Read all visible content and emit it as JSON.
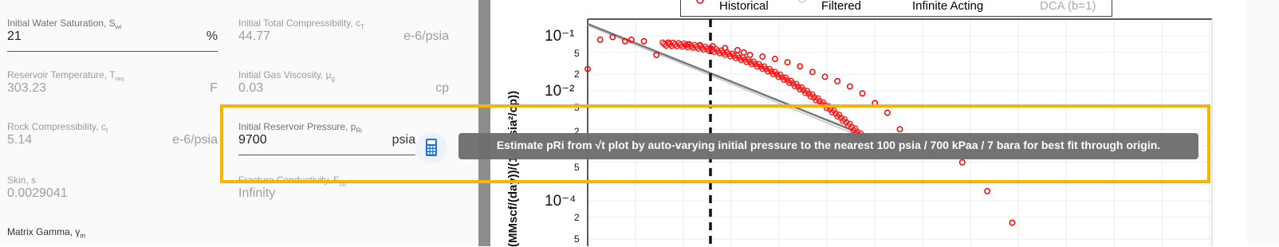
{
  "fields": [
    {
      "label": "Initial Water Saturation, S",
      "sub": "wi",
      "value": "21",
      "unit": "%",
      "active": true
    },
    {
      "label": "Initial Total Compressibility, c",
      "sub": "T",
      "value": "44.77",
      "unit": "e-6/psia",
      "active": false
    },
    {
      "label": "Reservoir Temperature, T",
      "sub": "res",
      "value": "303.23",
      "unit": "F",
      "active": false
    },
    {
      "label": "Initial Gas Viscosity, μ",
      "sub": "g",
      "value": "0.03",
      "unit": "cp",
      "active": false
    },
    {
      "label": "Rock Compressibility, c",
      "sub": "f",
      "value": "5.14",
      "unit": "e-6/psia",
      "active": false
    },
    {
      "label": "Initial Reservoir Pressure, p",
      "sub": "Ri",
      "value": "9700",
      "unit": "psia",
      "active": true
    },
    {
      "label": "Skin, s",
      "sub": "",
      "value": "0.0029041",
      "unit": "",
      "active": false
    },
    {
      "label": "Fracture Conductivity, F",
      "sub": "cd",
      "value": "Infinity",
      "unit": "",
      "active": false
    },
    {
      "label": "Matrix Gamma, γ",
      "sub": "m",
      "value": "",
      "unit": "",
      "active": false
    }
  ],
  "calculator": {
    "icon": "calculator-icon"
  },
  "tooltip": "Estimate pRi from √t plot by auto-varying initial pressure to the nearest 100 psia / 700 kPaa / 7 bara for best fit through origin.",
  "chart_data": {
    "type": "scatter",
    "ylabel": "(MMscf/(day))/(10⁶psia²/cp))",
    "ylog": true,
    "y_ticks": [
      "10⁻¹",
      "10⁻²",
      "10⁻⁴"
    ],
    "y_minor_ticks": [
      "5",
      "2",
      "5",
      "2",
      "5",
      "2",
      "5"
    ],
    "legend": [
      {
        "name": "Historical",
        "color": "#ff0000",
        "marker": "circle"
      },
      {
        "name": "Filtered",
        "color": "#bbbbbb",
        "marker": "circle"
      },
      {
        "name": "Infinite Acting",
        "color": "#555555",
        "marker": "line"
      },
      {
        "name": "DCA (b=1)",
        "color": "#aaaaaa",
        "marker": "line"
      }
    ],
    "grid": true,
    "series": [
      {
        "name": "Historical",
        "x_rel": [
          0.0,
          0.02,
          0.04,
          0.06,
          0.07,
          0.09,
          0.11,
          0.13,
          0.16,
          0.18,
          0.2,
          0.22,
          0.24,
          0.25,
          0.26,
          0.28,
          0.3,
          0.32,
          0.34,
          0.36,
          0.38,
          0.4,
          0.42,
          0.44,
          0.46,
          0.48,
          0.5,
          0.52,
          0.55,
          0.6,
          0.64,
          0.68
        ],
        "y_values": [
          0.025,
          0.085,
          0.095,
          0.08,
          0.085,
          0.08,
          0.045,
          0.075,
          0.07,
          0.068,
          0.065,
          0.06,
          0.055,
          0.05,
          0.045,
          0.042,
          0.038,
          0.033,
          0.028,
          0.022,
          0.018,
          0.015,
          0.012,
          0.009,
          0.006,
          0.004,
          0.002,
          0.0013,
          0.0007,
          0.0005,
          0.00015,
          4e-05
        ]
      }
    ]
  }
}
